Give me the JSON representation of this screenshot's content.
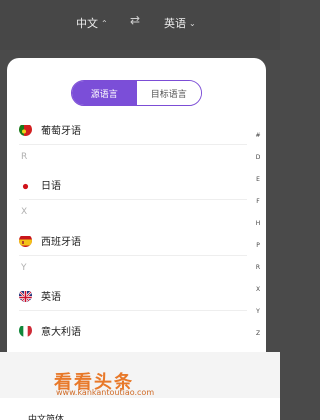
{
  "header": {
    "source_language": "中文",
    "target_language": "英语",
    "swap_icon": "⇄",
    "caret_up": "^",
    "caret_down": "v"
  },
  "segmented_control": {
    "source_tab": "源语言",
    "target_tab": "目标语言",
    "active": "source",
    "accent_color": "#7b4ed8"
  },
  "list": [
    {
      "type": "item",
      "name": "葡萄牙语",
      "flag": "portugal-flag-icon"
    },
    {
      "type": "letter",
      "name": "R"
    },
    {
      "type": "item",
      "name": "日语",
      "flag": "japan-flag-icon"
    },
    {
      "type": "letter",
      "name": "X"
    },
    {
      "type": "item",
      "name": "西班牙语",
      "flag": "spain-flag-icon"
    },
    {
      "type": "letter",
      "name": "Y"
    },
    {
      "type": "item",
      "name": "英语",
      "flag": "uk-flag-icon"
    },
    {
      "type": "item",
      "name": "意大利语",
      "flag": "italy-flag-icon"
    }
  ],
  "index_letters": [
    "#",
    "D",
    "E",
    "F",
    "H",
    "P",
    "R",
    "X",
    "Y",
    "Z"
  ],
  "watermark": {
    "title": "看看头条",
    "subtitle": "www.kankantoutiao.com"
  },
  "bottom_partial_text": "中文简体"
}
